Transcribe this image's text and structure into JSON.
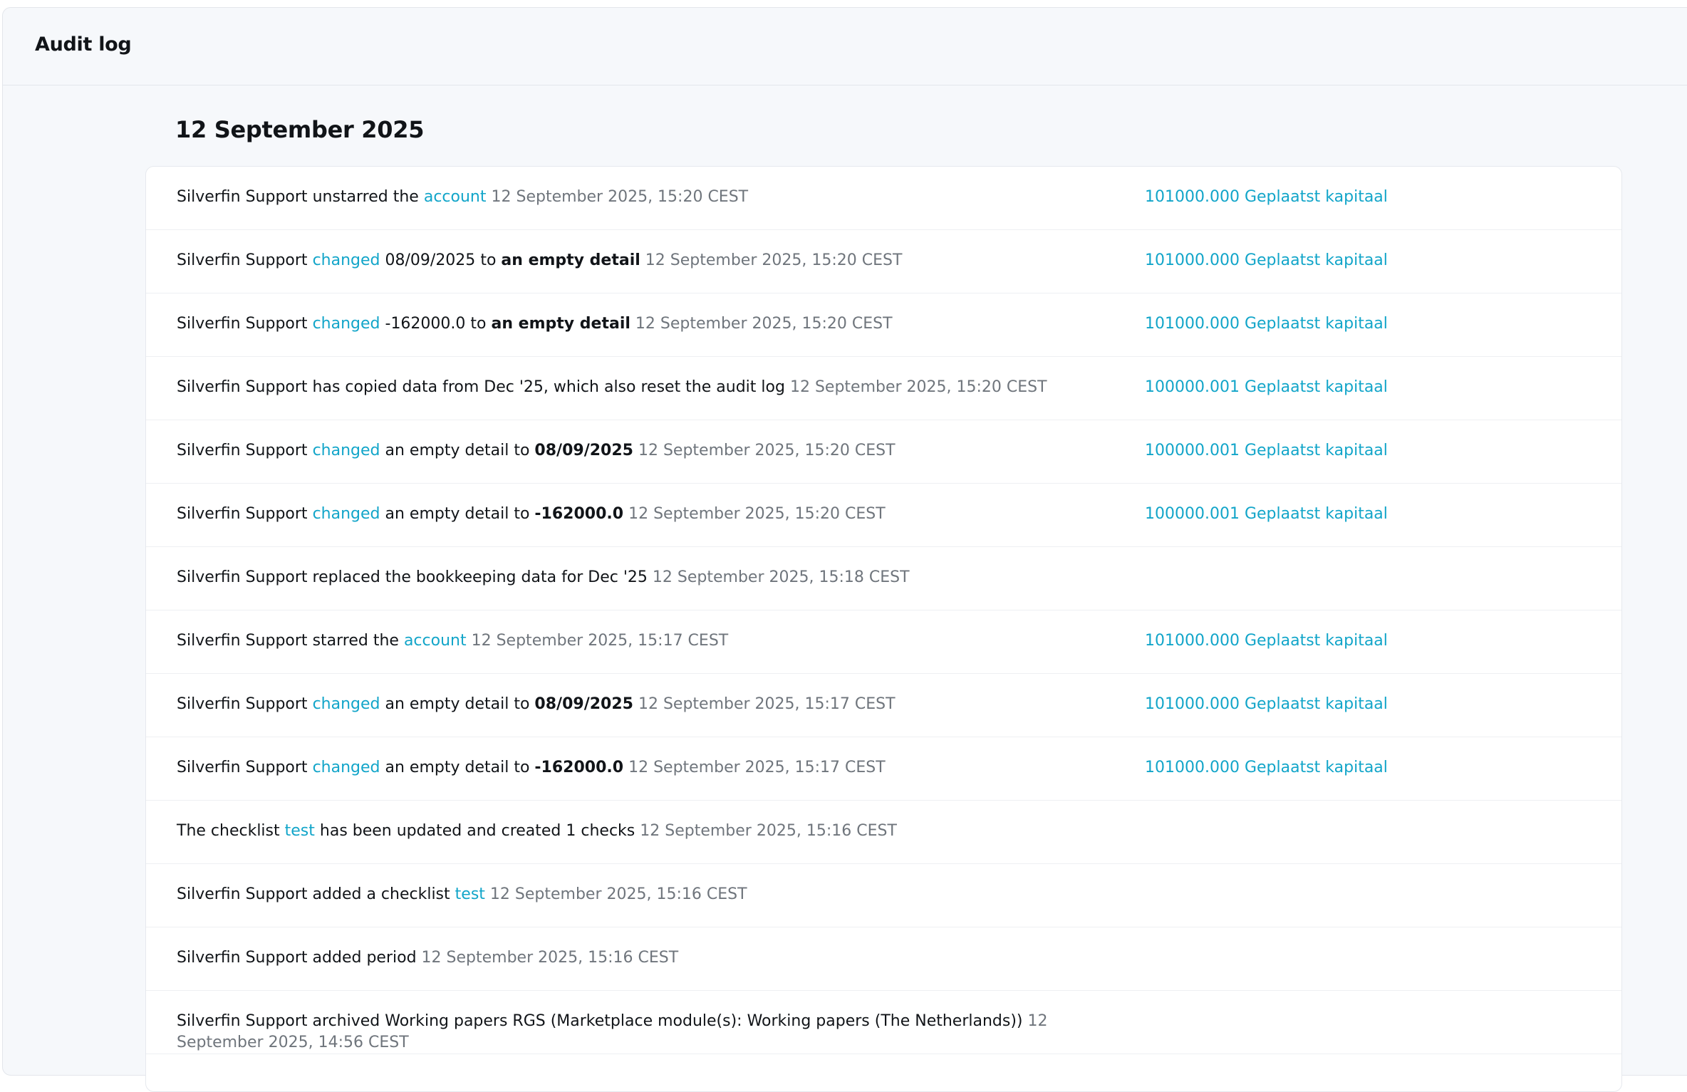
{
  "header": {
    "title": "Audit log"
  },
  "day": {
    "heading": "12 September 2025"
  },
  "rows": [
    {
      "actor": "Silverfin Support",
      "verb": "unstarred the",
      "link": "account",
      "time": "12 September 2025, 15:20 CEST",
      "account": "101000.000 Geplaatst kapitaal"
    },
    {
      "actor": "Silverfin Support",
      "link": "changed",
      "old": "08/09/2025",
      "to": "to",
      "new": "an empty detail",
      "time": "12 September 2025, 15:20 CEST",
      "account": "101000.000 Geplaatst kapitaal"
    },
    {
      "actor": "Silverfin Support",
      "link": "changed",
      "old": "-162000.0",
      "to": "to",
      "new": "an empty detail",
      "time": "12 September 2025, 15:20 CEST",
      "account": "101000.000 Geplaatst kapitaal"
    },
    {
      "text": "Silverfin Support has copied data from Dec '25, which also reset the audit log",
      "time": "12 September 2025, 15:20 CEST",
      "account": "100000.001 Geplaatst kapitaal"
    },
    {
      "actor": "Silverfin Support",
      "link": "changed",
      "old": "an empty detail",
      "to": "to",
      "new": "08/09/2025",
      "time": "12 September 2025, 15:20 CEST",
      "account": "100000.001 Geplaatst kapitaal"
    },
    {
      "actor": "Silverfin Support",
      "link": "changed",
      "old": "an empty detail",
      "to": "to",
      "new": "-162000.0",
      "time": "12 September 2025, 15:20 CEST",
      "account": "100000.001 Geplaatst kapitaal"
    },
    {
      "text": "Silverfin Support replaced the bookkeeping data for Dec '25",
      "time": "12 September 2025, 15:18 CEST"
    },
    {
      "actor": "Silverfin Support",
      "verb": "starred the",
      "link": "account",
      "time": "12 September 2025, 15:17 CEST",
      "account": "101000.000 Geplaatst kapitaal"
    },
    {
      "actor": "Silverfin Support",
      "link": "changed",
      "old": "an empty detail",
      "to": "to",
      "new": "08/09/2025",
      "time": "12 September 2025, 15:17 CEST",
      "account": "101000.000 Geplaatst kapitaal"
    },
    {
      "actor": "Silverfin Support",
      "link": "changed",
      "old": "an empty detail",
      "to": "to",
      "new": "-162000.0",
      "time": "12 September 2025, 15:17 CEST",
      "account": "101000.000 Geplaatst kapitaal"
    },
    {
      "pre": "The checklist",
      "link": "test",
      "post": "has been updated and created 1 checks",
      "time": "12 September 2025, 15:16 CEST"
    },
    {
      "pre": "Silverfin Support added a checklist",
      "link": "test",
      "time": "12 September 2025, 15:16 CEST"
    },
    {
      "text": "Silverfin Support added period",
      "time": "12 September 2025, 15:16 CEST"
    },
    {
      "text": "Silverfin Support archived Working papers RGS (Marketplace module(s): Working papers (The Netherlands))",
      "time": "12 September 2025, 14:56 CEST"
    }
  ]
}
